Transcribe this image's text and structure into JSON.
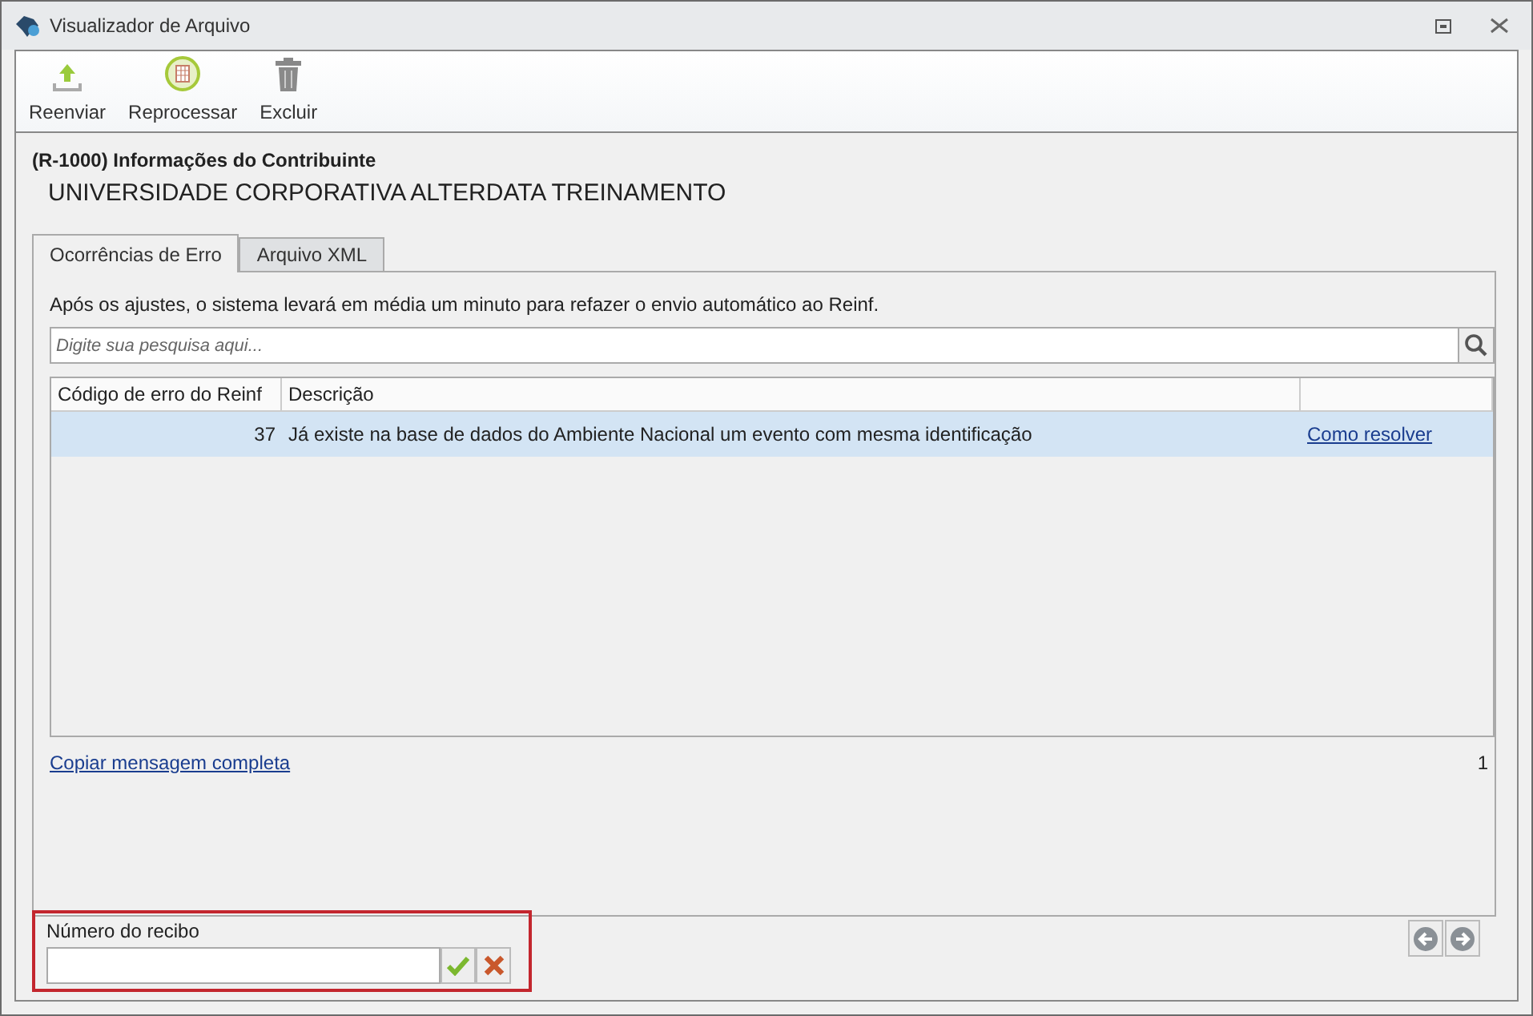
{
  "window": {
    "title": "Visualizador de Arquivo"
  },
  "toolbar": [
    {
      "kind": "upload",
      "label": "Reenviar"
    },
    {
      "kind": "reprocess",
      "label": "Reprocessar"
    },
    {
      "kind": "trash",
      "label": "Excluir"
    }
  ],
  "header": {
    "event": "(R-1000) Informações do Contribuinte",
    "company": "UNIVERSIDADE CORPORATIVA ALTERDATA TREINAMENTO"
  },
  "tabs": [
    {
      "label": "Ocorrências de Erro",
      "selected": true
    },
    {
      "label": "Arquivo XML",
      "selected": false
    }
  ],
  "notice": "Após os ajustes, o sistema levará em média um minuto para refazer o envio automático ao Reinf.",
  "search": {
    "placeholder": "Digite sua pesquisa aqui..."
  },
  "table": {
    "columns": [
      "Código de erro do Reinf",
      "Descrição"
    ],
    "rows": [
      {
        "code": "37",
        "description": "Já existe na base de dados do Ambiente Nacional um evento com mesma identificação",
        "action": "Como resolver",
        "selected": true
      }
    ]
  },
  "copy_link": "Copiar mensagem completa",
  "count": "1",
  "receipt": {
    "label": "Número do recibo"
  }
}
